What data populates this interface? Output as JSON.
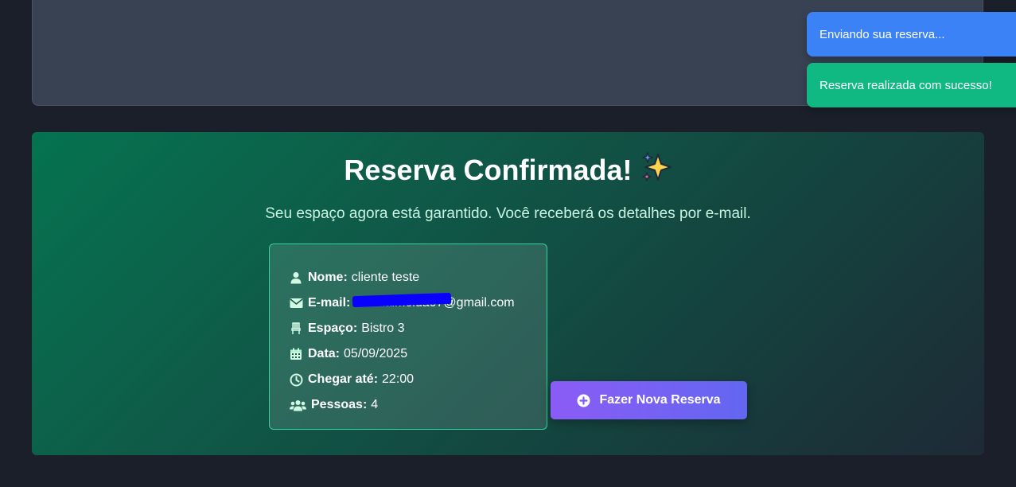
{
  "toasts": {
    "sending": "Enviando sua reserva...",
    "success": "Reserva realizada com sucesso!"
  },
  "confirmation": {
    "title": "Reserva Confirmada!",
    "title_emoji": "sparkles-icon",
    "subtitle": "Seu espaço agora está garantido. Você receberá os detalhes por e-mail.",
    "details": {
      "name_label": "Nome:",
      "name_value": "cliente teste",
      "email_label": "E-mail:",
      "email_value": "thaliaalmeida07@gmail.com",
      "space_label": "Espaço:",
      "space_value": "Bistro 3",
      "date_label": "Data:",
      "date_value": "05/09/2025",
      "arrive_label": "Chegar até:",
      "arrive_value": "22:00",
      "people_label": "Pessoas:",
      "people_value": "4"
    },
    "new_booking_button": "Fazer Nova Reserva"
  },
  "colors": {
    "toast_info": "#3b82f6",
    "toast_success": "#10b981",
    "card_accent": "#34d399",
    "button_start": "#8b5cf6",
    "button_end": "#6366f1"
  }
}
